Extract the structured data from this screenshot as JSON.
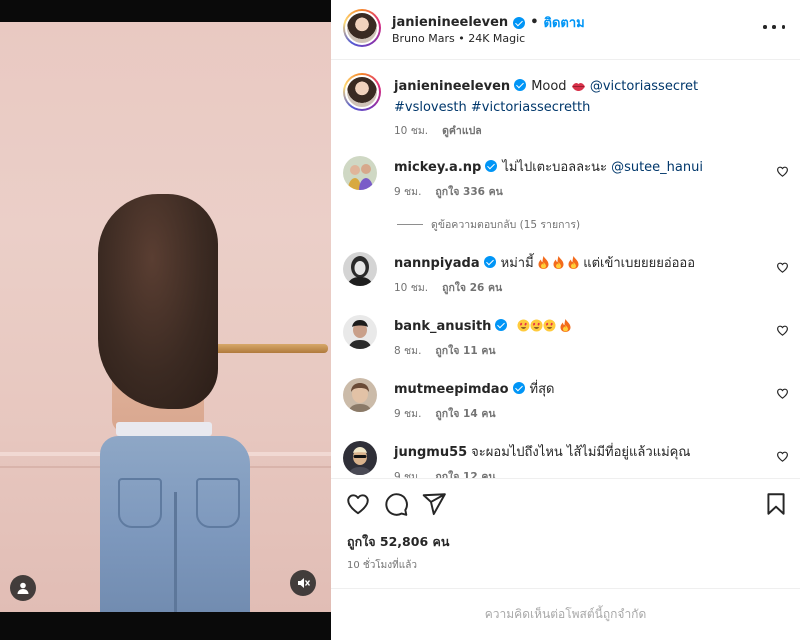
{
  "post": {
    "username": "janienineeleven",
    "follow_label": "ติดตาม",
    "separator": "•",
    "audio": "Bruno Mars • 24K Magic",
    "caption_prefix": "Mood",
    "caption_mention": "@victoriassecret",
    "caption_tags_1": "#vslovesth",
    "caption_tags_2": "#victoriassecretth",
    "caption_time": "10 ชม.",
    "caption_translate": "ดูคำแปล"
  },
  "comments": [
    {
      "username": "mickey.a.np",
      "text": "ไม่ไปเตะบอลละนะ",
      "mention": "@sutee_hanui",
      "time": "9 ชม.",
      "likes": "ถูกใจ 336 คน"
    },
    {
      "username": "nannpiyada",
      "text_before": "หม่ามี้",
      "text_after": "แต่เข้าเบยยยยอ่อออ",
      "time": "10 ชม.",
      "likes": "ถูกใจ 26 คน"
    },
    {
      "username": "bank_anusith",
      "time": "8 ชม.",
      "likes": "ถูกใจ 11 คน"
    },
    {
      "username": "mutmeepimdao",
      "text": "ที่สุด",
      "time": "9 ชม.",
      "likes": "ถูกใจ 14 คน"
    },
    {
      "username": "jungmu55",
      "text": "จะผอมไปถึงไหน ไส้ไม่มีที่อยู่แล้วแม่คุณ",
      "time": "9 ชม.",
      "likes": "ถูกใจ 12 คน"
    }
  ],
  "replies_label": "ดูข้อความตอบกลับ (15 รายการ)",
  "likes_total": "ถูกใจ 52,806 คน",
  "posted_ago": "10 ชั่วโมงที่แล้ว",
  "comments_limited": "ความคิดเห็นต่อโพสต์นี้ถูกจำกัด",
  "icons": {
    "heart": "heart-icon",
    "comment": "comment-icon",
    "share": "share-icon",
    "bookmark": "bookmark-icon",
    "more": "more-icon",
    "verified": "verified-badge-icon",
    "user": "user-tag-icon",
    "mute": "muted-audio-icon",
    "fire": "fire-emoji",
    "heart_eyes": "heart-eyes-emoji",
    "lips": "lips-emoji"
  },
  "colors": {
    "accent": "#0095f6",
    "tag": "#00376b",
    "muted": "#737373"
  }
}
